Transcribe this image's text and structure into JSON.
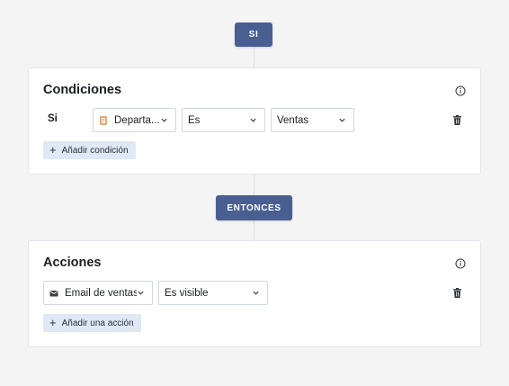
{
  "flow": {
    "if_label": "SI",
    "then_label": "ENTONCES"
  },
  "conditions": {
    "title": "Condiciones",
    "row": {
      "prefix": "Si",
      "field": "Departa...",
      "field_icon": "building-icon",
      "operator": "Es",
      "value": "Ventas"
    },
    "add_label": "Añadir condición"
  },
  "actions": {
    "title": "Acciones",
    "row": {
      "target": "Email de ventas",
      "target_icon": "email-icon",
      "action": "Es visible"
    },
    "add_label": "Añadir una acción"
  },
  "colors": {
    "pill": "#4a5f91",
    "add_button_bg": "#dfe8f5",
    "field_icon": "#e0711f"
  }
}
